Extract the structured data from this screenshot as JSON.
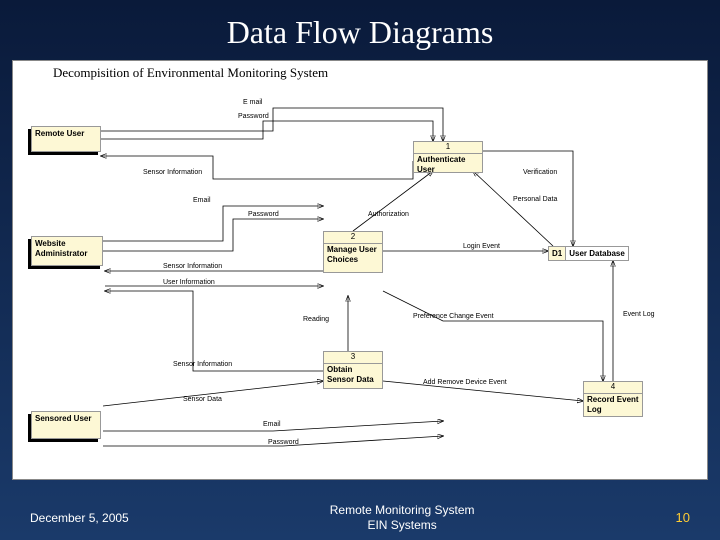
{
  "slide": {
    "title": "Data Flow Diagrams",
    "diagram_title": "Decompisition of Environmental Monitoring System"
  },
  "entities": {
    "remote_user": "Remote User",
    "website_admin": "Website Administrator",
    "sensored_user": "Sensored User"
  },
  "processes": {
    "p1_num": "1",
    "p1": "Authenticate User",
    "p2_num": "2",
    "p2": "Manage User Choices",
    "p3_num": "3",
    "p3": "Obtain Sensor Data",
    "p4_num": "4",
    "p4": "Record Event Log"
  },
  "stores": {
    "d1_label": "D1",
    "d1": "User Database"
  },
  "flows": {
    "email1": "E mail",
    "password1": "Password",
    "sensor_info1": "Sensor Information",
    "email2": "Email",
    "password2": "Password",
    "authorization": "Authorization",
    "verification": "Verification",
    "personal_data": "Personal Data",
    "login_event": "Login Event",
    "sensor_info2": "Sensor Information",
    "user_info": "User Information",
    "reading": "Reading",
    "preference_change": "Preference Change Event",
    "event_log": "Event Log",
    "sensor_info3": "Sensor Information",
    "sensor_data": "Sensor Data",
    "add_remove": "Add Remove Device Event",
    "email3": "Email",
    "password3": "Password"
  },
  "footer": {
    "date": "December 5, 2005",
    "center1": "Remote Monitoring System",
    "center2": "EIN Systems",
    "page": "10"
  }
}
